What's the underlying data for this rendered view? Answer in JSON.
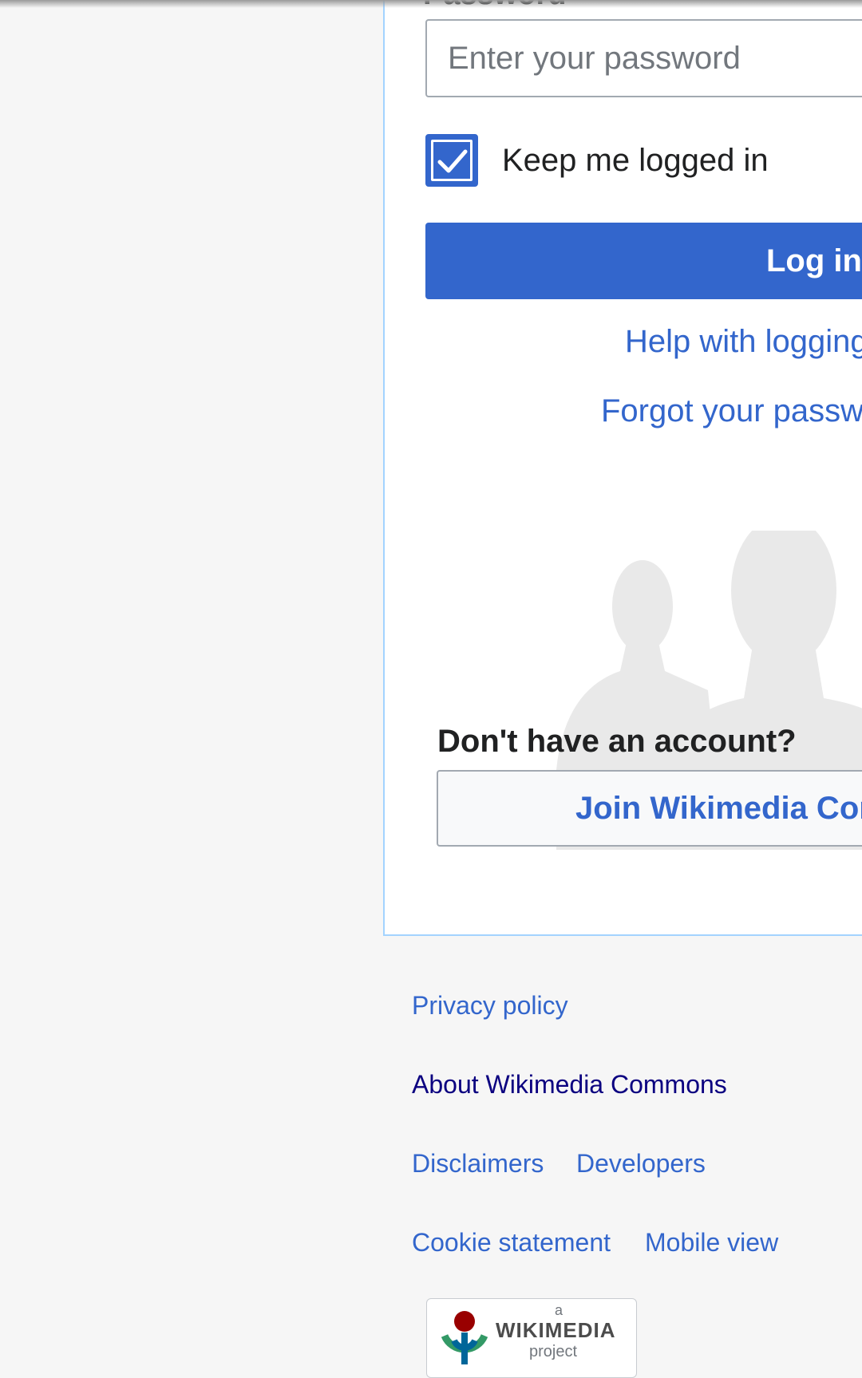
{
  "form": {
    "password_label": "Password",
    "password_placeholder": "Enter your password",
    "remember_label": "Keep me logged in",
    "remember_checked": true,
    "login_button": "Log in",
    "help_link": "Help with logging in",
    "forgot_link": "Forgot your password?",
    "no_account_heading": "Don't have an account?",
    "join_button": "Join Wikimedia Commons"
  },
  "footer": {
    "links": [
      "Privacy policy",
      "About Wikimedia Commons",
      "Disclaimers",
      "Developers",
      "Cookie statement",
      "Mobile view"
    ],
    "badge": {
      "prefix": "a",
      "name": "WIKIMEDIA",
      "suffix": "project"
    }
  },
  "colors": {
    "accent": "#3366cc",
    "visited_link": "#0b0080",
    "card_border": "#a3d3ff",
    "page_background": "#f6f6f6",
    "text": "#202122"
  },
  "icons": [
    "checkmark-icon",
    "users-silhouette-icon",
    "wikimedia-logo-icon"
  ]
}
